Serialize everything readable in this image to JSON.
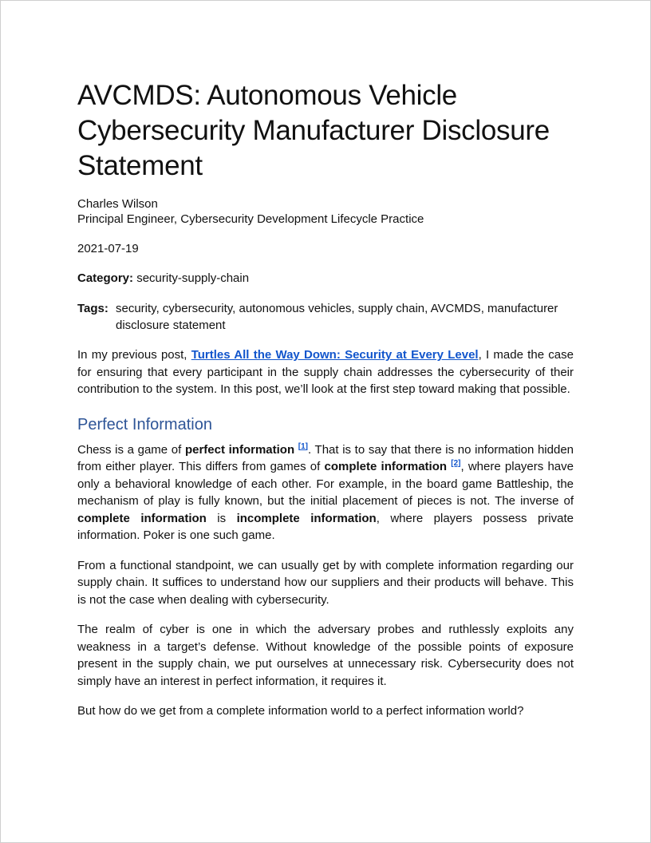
{
  "document": {
    "title": "AVCMDS: Autonomous Vehicle Cybersecurity Manufacturer Disclosure Statement",
    "author": "Charles Wilson",
    "role": "Principal Engineer, Cybersecurity Development Lifecycle Practice",
    "date": "2021-07-19",
    "category_label": "Category:",
    "category_value": "security-supply-chain",
    "tags_label": "Tags:",
    "tags_value": "security, cybersecurity, autonomous vehicles, supply chain, AVCMDS, manufacturer disclosure statement"
  },
  "intro": {
    "before_link": "In my previous post, ",
    "link_text": "Turtles All the Way Down: Security at Every Level",
    "after_link": ", I made the case for ensuring that every participant in the supply chain addresses the cybersecurity of their contribution to the system. In this post, we’ll look at the first step toward making that possible."
  },
  "section": {
    "heading": "Perfect Information",
    "p1": {
      "t1": "Chess is a game of ",
      "b1": "perfect information",
      "ref1": "[1]",
      "t2": ". That is to say that there is no information hidden from either player. This differs from games of ",
      "b2": "complete information",
      "ref2": "[2]",
      "t3": ", where players have only a behavioral knowledge of each other. For example, in the board game Battleship, the mechanism of play is fully known, but the initial placement of pieces is not. The inverse of ",
      "b3": "complete information",
      "t4": " is ",
      "b4": "incomplete information",
      "t5": ", where players possess private information. Poker is one such game."
    },
    "p2": "From a functional standpoint, we can usually get by with complete information regarding our supply chain. It suffices to understand how our suppliers and their products will behave. This is not the case when dealing with cybersecurity.",
    "p3": "The realm of cyber is one in which the adversary probes and ruthlessly exploits any weakness in a target’s defense. Without knowledge of the possible points of exposure present in the supply chain, we put ourselves at unnecessary risk. Cybersecurity does not simply have an interest in perfect information, it requires it.",
    "p4": "But how do we get from a complete information world to a perfect information world?"
  },
  "colors": {
    "link": "#1155cc",
    "heading": "#2e5597",
    "text": "#111111"
  }
}
